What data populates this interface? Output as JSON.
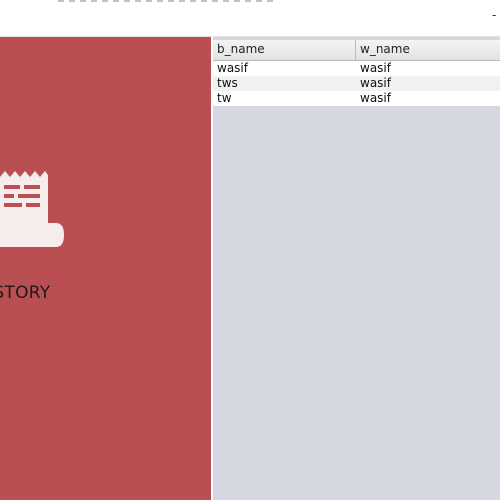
{
  "window": {
    "top_right_mark": "-"
  },
  "sidebar": {
    "icon": "receipt-icon",
    "label": "ISTORY",
    "accent_color": "#b94f52"
  },
  "table": {
    "columns": [
      "b_name",
      "w_name"
    ],
    "rows": [
      [
        "wasif",
        "wasif"
      ],
      [
        "tws",
        "wasif"
      ],
      [
        "tw",
        "wasif"
      ]
    ]
  }
}
